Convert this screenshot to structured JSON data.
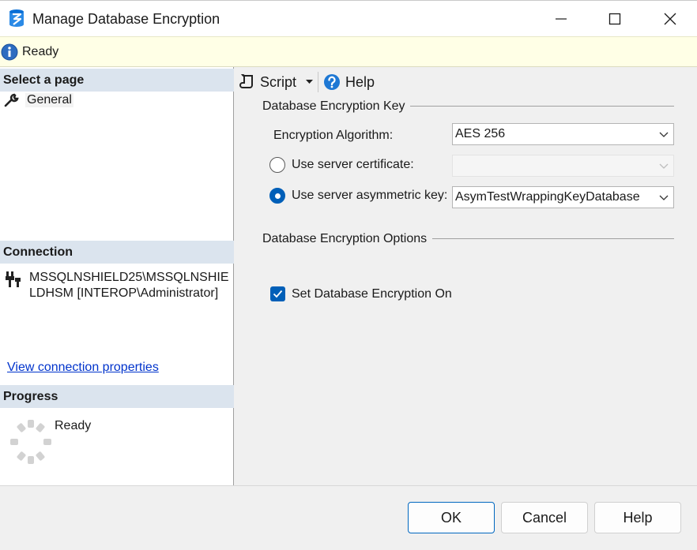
{
  "window": {
    "title": "Manage Database Encryption"
  },
  "status": {
    "text": "Ready"
  },
  "left": {
    "select_page_header": "Select a page",
    "pages": [
      {
        "label": "General"
      }
    ],
    "connection_header": "Connection",
    "connection_text": "MSSQLNSHIELD25\\MSSQLNSHIELDHSM [INTEROP\\Administrator]",
    "connection_link": "View connection properties",
    "progress_header": "Progress",
    "progress_text": "Ready"
  },
  "toolbar": {
    "script_label": "Script",
    "help_label": "Help"
  },
  "form": {
    "key_group": "Database Encryption Key",
    "algorithm_label": "Encryption Algorithm:",
    "algorithm_value": "AES 256",
    "cert_radio_label": "Use server certificate:",
    "cert_value": "",
    "asym_radio_label": "Use server asymmetric key:",
    "asym_value": "AsymTestWrappingKeyDatabase",
    "options_group": "Database Encryption Options",
    "encryption_on_label": "Set Database Encryption On",
    "encryption_on": true,
    "selected_radio": "asymmetric-key"
  },
  "buttons": {
    "ok": "OK",
    "cancel": "Cancel",
    "help": "Help"
  },
  "colors": {
    "accent": "#005fb8",
    "status_bg": "#ffffe6",
    "section_header_bg": "#dbe4ee",
    "link": "#0033cc"
  },
  "icons": {
    "app": "database-encryption-icon",
    "status": "info-icon",
    "page": "wrench-icon",
    "connection": "plug-icon",
    "progress": "spinner-icon",
    "script": "script-icon",
    "help": "help-icon"
  }
}
